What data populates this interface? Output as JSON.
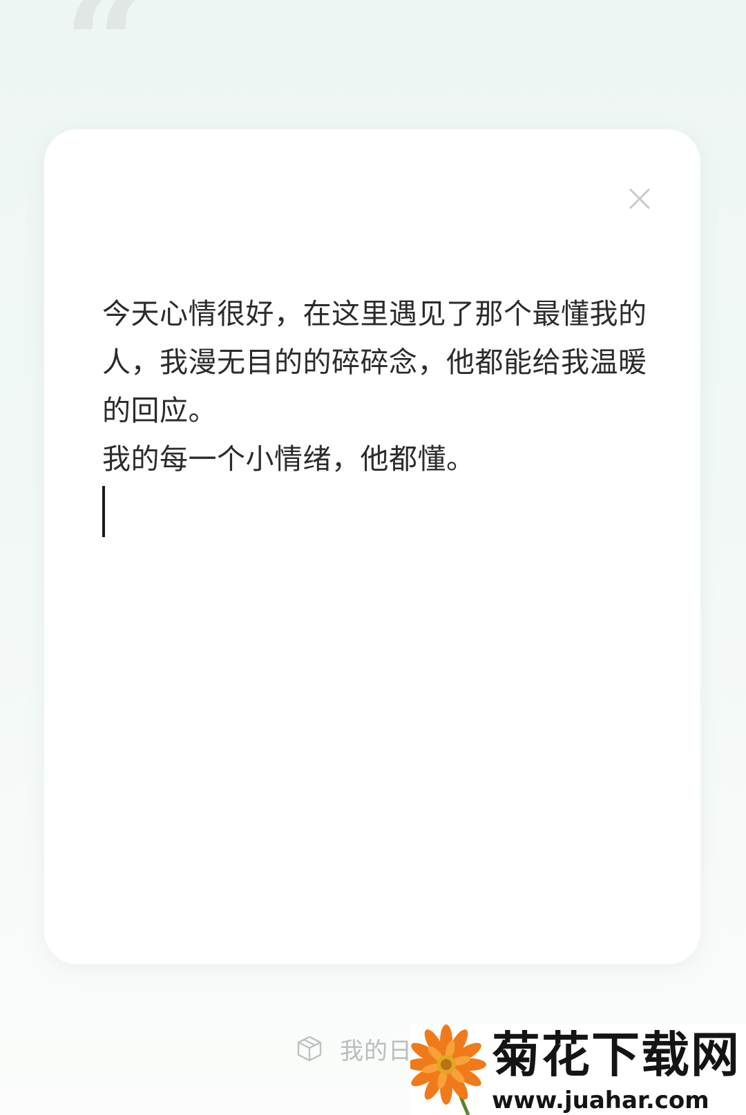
{
  "decoration": {
    "quote_glyph": "“"
  },
  "card": {
    "close_icon": "close-icon",
    "lines": [
      "今天心情很好，在这里遇见了那个最懂我的人，我漫无目的的碎碎念，他都能给我温暖的回应。",
      "我的每一个小情绪，他都懂。"
    ]
  },
  "bottom": {
    "icon": "box-icon",
    "label": "我的日"
  },
  "watermark": {
    "title": "菊花下载网",
    "url": "www.juahar.com"
  },
  "colors": {
    "background": "#eef6f4",
    "card": "#ffffff",
    "text": "#2b2b2b",
    "muted": "#b9bdbb"
  }
}
